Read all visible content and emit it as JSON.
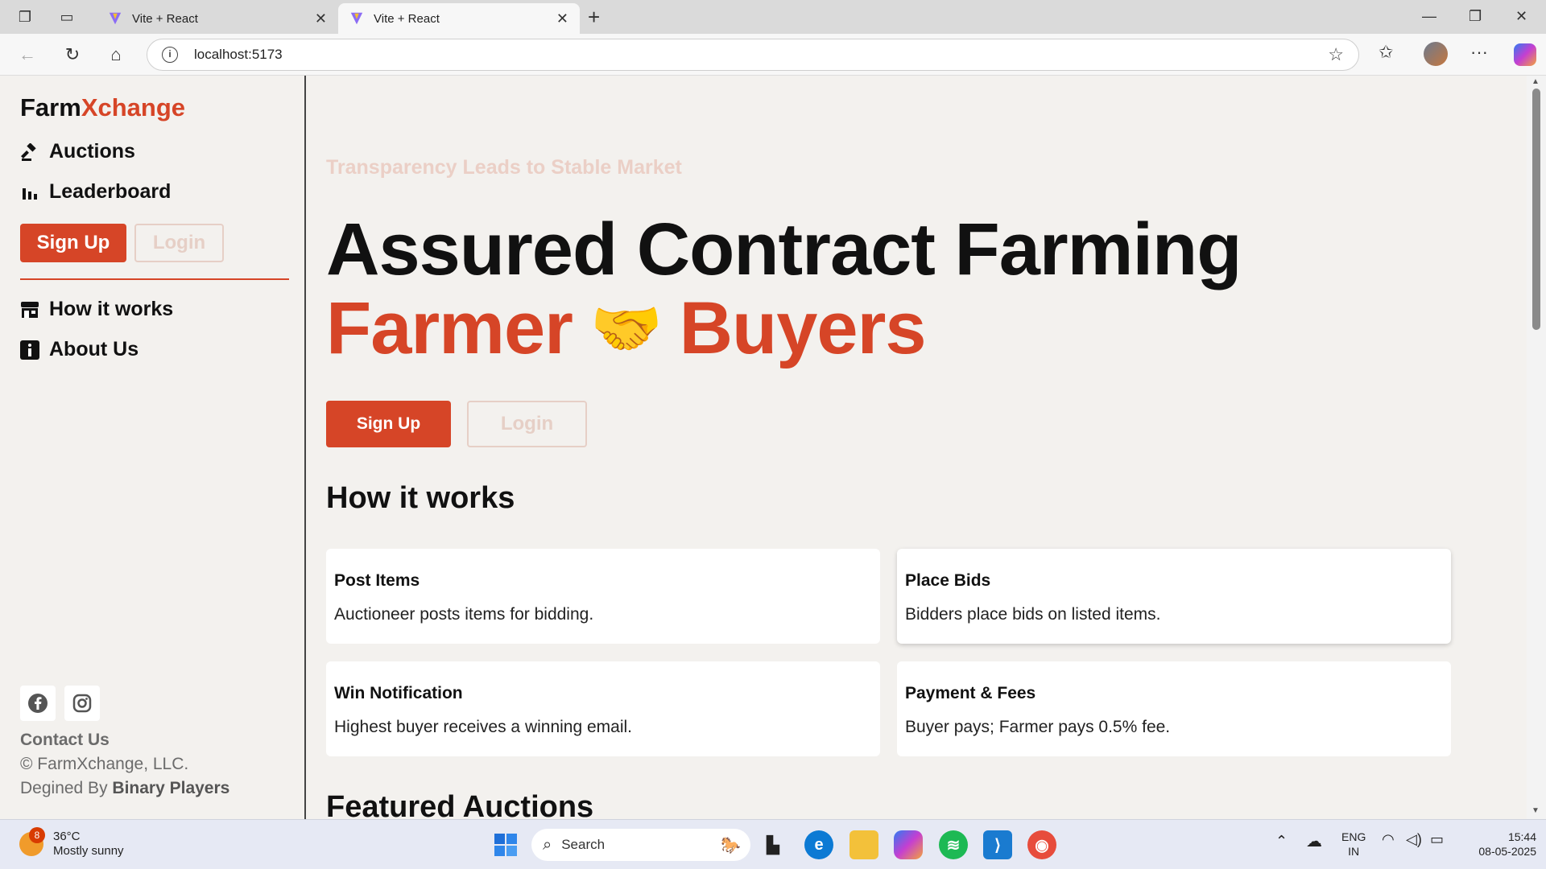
{
  "browser": {
    "tabs": [
      {
        "title": "Vite + React",
        "active": false
      },
      {
        "title": "Vite + React",
        "active": true
      }
    ],
    "url": "localhost:5173"
  },
  "sidebar": {
    "brand_part1": "Farm",
    "brand_part2": "Xchange",
    "nav": {
      "auctions": "Auctions",
      "leaderboard": "Leaderboard",
      "how": "How it works",
      "about": "About Us"
    },
    "signup": "Sign Up",
    "login": "Login",
    "contact": "Contact Us",
    "copyright": "© FarmXchange, LLC.",
    "designed_prefix": "Degined By ",
    "designed_by": "Binary Players"
  },
  "hero": {
    "kicker": "Transparency Leads to Stable Market",
    "line1": "Assured Contract Farming",
    "farmer": "Farmer",
    "emoji": "🤝",
    "buyers": "Buyers",
    "signup": "Sign Up",
    "login": "Login"
  },
  "how_it_works": {
    "heading": "How it works",
    "cards": [
      {
        "title": "Post Items",
        "desc": "Auctioneer posts items for bidding."
      },
      {
        "title": "Place Bids",
        "desc": "Bidders place bids on listed items."
      },
      {
        "title": "Win Notification",
        "desc": "Highest buyer receives a winning email."
      },
      {
        "title": "Payment & Fees",
        "desc": "Buyer pays; Farmer pays 0.5% fee."
      }
    ]
  },
  "featured": {
    "heading": "Featured Auctions"
  },
  "taskbar": {
    "weather_temp": "36°C",
    "weather_desc": "Mostly sunny",
    "weather_badge": "8",
    "search": "Search",
    "lang1": "ENG",
    "lang2": "IN",
    "time": "15:44",
    "date": "08-05-2025"
  },
  "colors": {
    "accent": "#d64527",
    "muted_accent": "#ebcfc6",
    "background": "#f3f1ee"
  }
}
